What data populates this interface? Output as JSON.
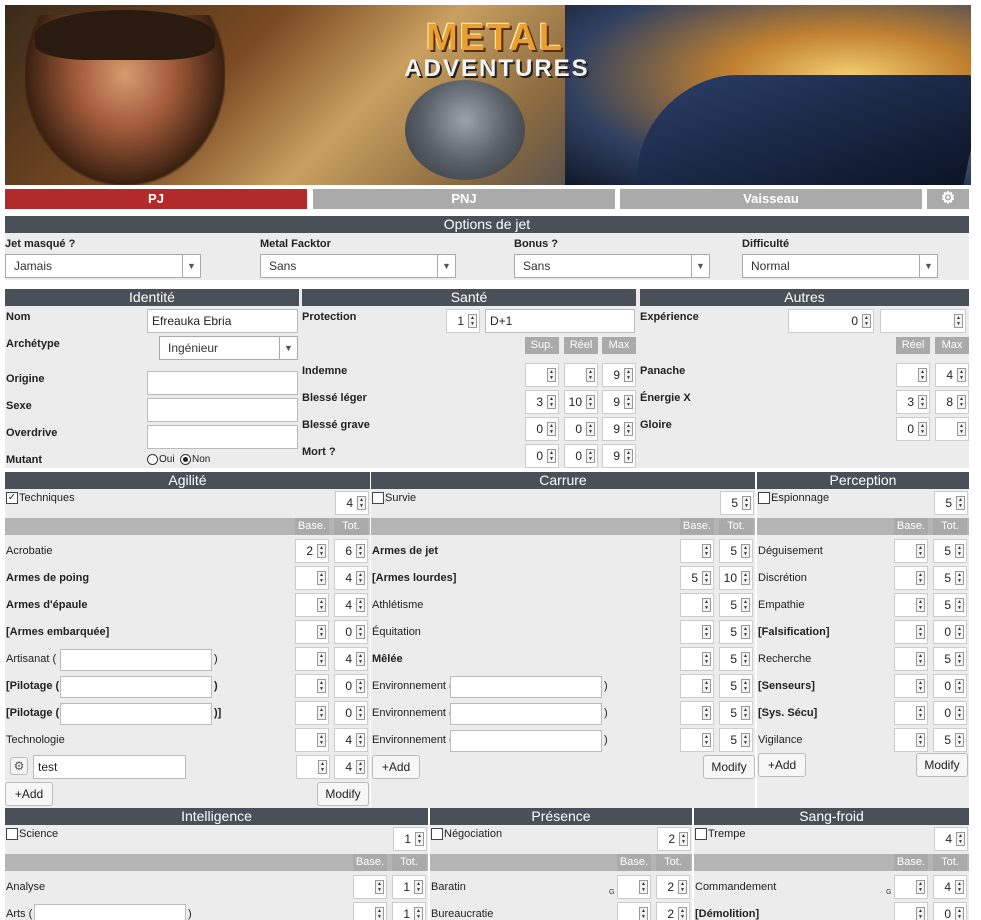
{
  "banner": {
    "logo_top": "METAL",
    "logo_bottom": "ADVENTURES"
  },
  "tabs": {
    "pj": "PJ",
    "pnj": "PNJ",
    "vaisseau": "Vaisseau"
  },
  "options": {
    "title": "Options de jet",
    "jet_label": "Jet masqué ?",
    "jet_value": "Jamais",
    "metal_label": "Metal Facktor",
    "metal_value": "Sans",
    "bonus_label": "Bonus ?",
    "bonus_value": "Sans",
    "diff_label": "Difficulté",
    "diff_value": "Normal"
  },
  "identite": {
    "title": "Identité",
    "nom_label": "Nom",
    "nom_value": "Efreauka Ebria",
    "arch_label": "Archétype",
    "arch_value": "Ingénieur",
    "origine": "Origine",
    "sexe": "Sexe",
    "overdrive": "Overdrive",
    "mutant": "Mutant",
    "oui": "Oui",
    "non": "Non"
  },
  "sante": {
    "title": "Santé",
    "protection": "Protection",
    "prot_num": "1",
    "prot_value": "D+1",
    "sup": "Sup.",
    "reel": "Réel",
    "max": "Max",
    "rows": [
      {
        "label": "Indemne",
        "sup": "",
        "reel": "",
        "max": "9"
      },
      {
        "label": "Blessé léger",
        "sup": "3",
        "reel": "10",
        "max": "9"
      },
      {
        "label": "Blessé grave",
        "sup": "0",
        "reel": "0",
        "max": "9"
      },
      {
        "label": "Mort ?",
        "sup": "0",
        "reel": "0",
        "max": "9"
      }
    ]
  },
  "autres": {
    "title": "Autres",
    "experience": "Expérience",
    "exp_value": "0",
    "reel": "Réel",
    "max": "Max",
    "rows": [
      {
        "label": "Panache",
        "reel": "",
        "max": "4"
      },
      {
        "label": "Énergie X",
        "reel": "3",
        "max": "8"
      },
      {
        "label": "Gloire",
        "reel": "0",
        "max": ""
      }
    ]
  },
  "common": {
    "base": "Base.",
    "tot": "Tot.",
    "add": "+Add",
    "modify": "Modify",
    "G": "G"
  },
  "agilite": {
    "title": "Agilité",
    "main": "Techniques",
    "main_val": "4",
    "rows": [
      {
        "label": "Acrobatie",
        "base": "2",
        "tot": "6"
      },
      {
        "label": "Armes de poing",
        "base": "",
        "tot": "4"
      },
      {
        "label": "Armes d'épaule",
        "base": "",
        "tot": "4"
      },
      {
        "label": "[Armes embarquée]",
        "base": "",
        "tot": "0"
      },
      {
        "label": "Artisanat (",
        "suffix": ")",
        "base": "",
        "tot": "4"
      },
      {
        "label": "[Pilotage (",
        "suffix": ")",
        "base": "",
        "tot": "0"
      },
      {
        "label": "[Pilotage (",
        "suffix": ")]",
        "base": "",
        "tot": "0"
      },
      {
        "label": "Technologie",
        "base": "",
        "tot": "4"
      }
    ],
    "custom_value": "test",
    "custom_tot": "4"
  },
  "carrure": {
    "title": "Carrure",
    "main": "Survie",
    "main_val": "5",
    "rows": [
      {
        "label": "Armes de jet",
        "base": "",
        "tot": "5"
      },
      {
        "label": "[Armes lourdes]",
        "base": "5",
        "tot": "10"
      },
      {
        "label": "Athlétisme",
        "base": "",
        "tot": "5"
      },
      {
        "label": "Équitation",
        "base": "",
        "tot": "5"
      },
      {
        "label": "Mêlée",
        "base": "",
        "tot": "5"
      },
      {
        "label": "Environnement (",
        "suffix": ")",
        "base": "",
        "tot": "5"
      },
      {
        "label": "Environnement (",
        "suffix": ")",
        "base": "",
        "tot": "5"
      },
      {
        "label": "Environnement (",
        "suffix": ")",
        "base": "",
        "tot": "5"
      }
    ]
  },
  "perception": {
    "title": "Perception",
    "main": "Espionnage",
    "main_val": "5",
    "rows": [
      {
        "label": "Déguisement",
        "base": "",
        "tot": "5"
      },
      {
        "label": "Discrétion",
        "base": "",
        "tot": "5"
      },
      {
        "label": "Empathie",
        "base": "",
        "tot": "5"
      },
      {
        "label": "[Falsification]",
        "base": "",
        "tot": "0"
      },
      {
        "label": "Recherche",
        "base": "",
        "tot": "5"
      },
      {
        "label": "[Senseurs]",
        "base": "",
        "tot": "0"
      },
      {
        "label": "[Sys. Sécu]",
        "base": "",
        "tot": "0"
      },
      {
        "label": "Vigilance",
        "base": "",
        "tot": "5"
      }
    ]
  },
  "intelligence": {
    "title": "Intelligence",
    "main": "Science",
    "main_val": "1",
    "rows": [
      {
        "label": "Analyse",
        "base": "",
        "tot": "1"
      },
      {
        "label": "Arts (",
        "suffix": ")",
        "base": "",
        "tot": "1"
      }
    ]
  },
  "presence": {
    "title": "Présence",
    "main": "Négociation",
    "main_val": "2",
    "rows": [
      {
        "label": "Baratin",
        "base": "",
        "tot": "2"
      },
      {
        "label": "Bureaucratie",
        "base": "",
        "tot": "2"
      }
    ]
  },
  "sangfroid": {
    "title": "Sang-froid",
    "main": "Trempe",
    "main_val": "4",
    "rows": [
      {
        "label": "Commandement",
        "base": "",
        "tot": "4"
      },
      {
        "label": "[Démolition]",
        "base": "",
        "tot": "0"
      }
    ]
  },
  "colors": {
    "active_tab": "#b22a2a",
    "inactive_tab": "#aaaaaa",
    "section": "#4a5058",
    "panel": "#ececec"
  }
}
